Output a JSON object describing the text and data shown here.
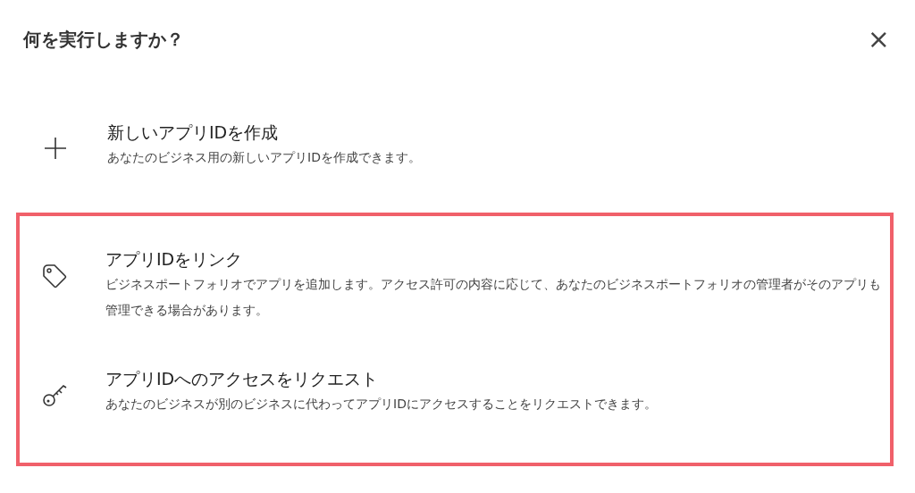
{
  "dialog": {
    "title": "何を実行しますか？",
    "close": "×"
  },
  "options": [
    {
      "kind": "plus",
      "title": "新しいアプリIDを作成",
      "description": "あなたのビジネス用の新しいアプリIDを作成できます。",
      "highlighted": false
    },
    {
      "kind": "tag",
      "title": "アプリIDをリンク",
      "description": "ビジネスポートフォリオでアプリを追加します。アクセス許可の内容に応じて、あなたのビジネスポートフォリオの管理者がそのアプリも管理できる場合があります。",
      "highlighted": true
    },
    {
      "kind": "key",
      "title": "アプリIDへのアクセスをリクエスト",
      "description": "あなたのビジネスが別のビジネスに代わってアプリIDにアクセスすることをリクエストできます。",
      "highlighted": true
    }
  ]
}
